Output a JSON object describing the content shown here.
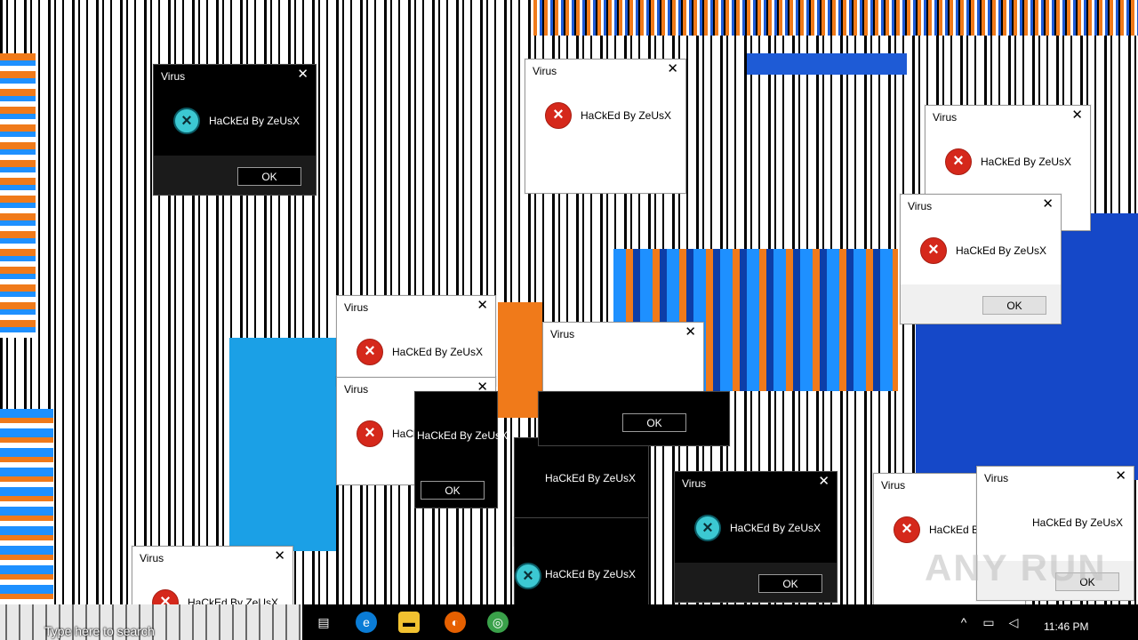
{
  "dialog": {
    "title": "Virus",
    "message": "HaCkEd By ZeUsX",
    "ok_label": "OK",
    "close_glyph": "✕",
    "error_icon": "error-x-icon"
  },
  "taskbar": {
    "search_placeholder": "Type here to search",
    "time": "11:46 PM",
    "apps": [
      "task-view-icon",
      "edge-icon",
      "file-explorer-icon",
      "firefox-icon",
      "app-icon"
    ],
    "tray_chevron": "^"
  },
  "watermark": "ANY RUN",
  "colors": {
    "error_red": "#d5281b",
    "dark_icon_teal": "#3cc8d2",
    "glitch_orange": "#f07a1a",
    "glitch_blue": "#1e90ff",
    "taskbar": "#000000"
  }
}
